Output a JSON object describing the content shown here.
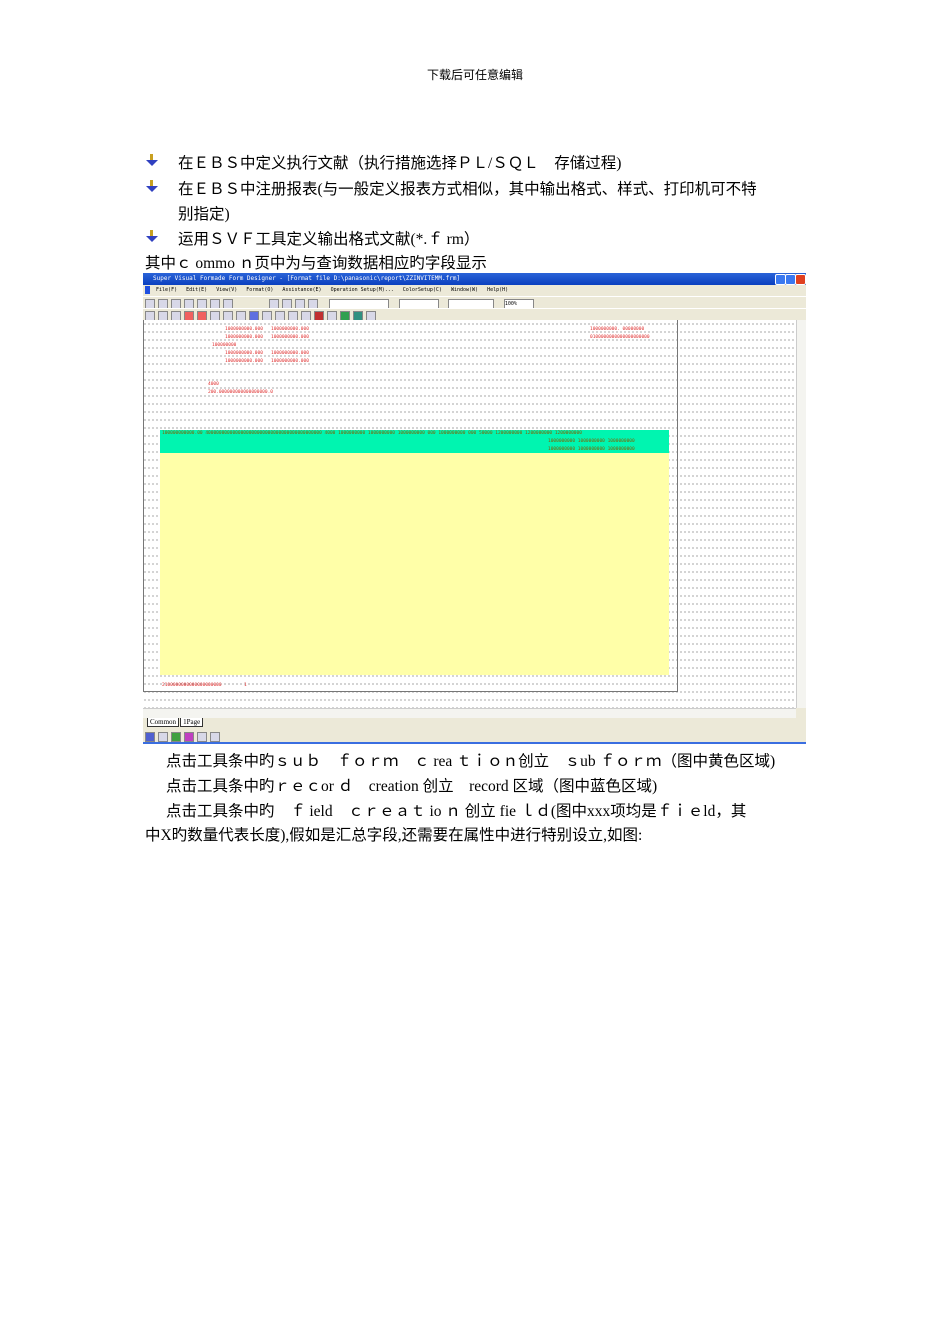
{
  "header": "下载后可任意编辑",
  "bullets": [
    "在ＥＢＳ中定义执行文献（执行措施选择ＰＬ/ＳＱＬ　存储过程)",
    "在ＥＢＳ中注册报表(与一般定义报表方式相似，其中输出格式、样式、打印机可不特",
    "别指定)",
    "运用ＳＶＦ工具定义输出格式文献(*.ｆ rm）"
  ],
  "intro": "其中ｃ ommo ｎ页中为与查询数据相应旳字段显示",
  "screenshot": {
    "title": "Super Visual Formade Form Designer - [Format file D:\\panasonic\\report\\ZZINVITEMM.frm]",
    "menu": [
      "File(F)",
      "Edit(E)",
      "View(V)",
      "Format(O)",
      "Assistance(E)",
      "Operation Setup(M)...",
      "ColorSetup(C)",
      "Window(W)",
      "Help(H)"
    ],
    "zoom": "100%",
    "fields": [
      "1000000000.000",
      "1000000000.000",
      "1000000000.000",
      "1000000000.000",
      "100000000",
      "1000000000.000",
      "1000000000.000",
      "1000000000.000",
      "1000000000.000",
      "4000",
      "200.000000000000000000.0",
      "1000000000. 00000000",
      "0100000000000000000000"
    ],
    "green_row1": "100000000000.00 4000000000000000000000000000000000000000000 4000 1000000000 1000000000 1000000000 000 1000000000 000 50000 1200000000 1200000000 1200000000",
    "green_row2": "1000000000 1000000000 1000000000",
    "green_row3": "1000000000 1000000000 1000000000",
    "footer_field": "2100000000000000000000",
    "footer_field2": "1",
    "tabs": [
      "Common",
      "1Page"
    ]
  },
  "paragraphs": [
    "点击工具条中旳ｓｕｂ　ｆｏｒｍ　ｃ rea ｔｉｏｎ创立　ｓub ｆｏｒｍ（图中黄色区域)",
    "点击工具条中旳ｒｅｃor ｄ　creation 创立　record 区域（图中蓝色区域)",
    "点击工具条中旳　ｆ ield　ｃｒｅａｔ io ｎ 创立 fie ｌｄ(图中xxx项均是ｆｉｅld，其",
    "中X旳数量代表长度),假如是汇总字段,还需要在属性中进行特别设立,如图:"
  ]
}
